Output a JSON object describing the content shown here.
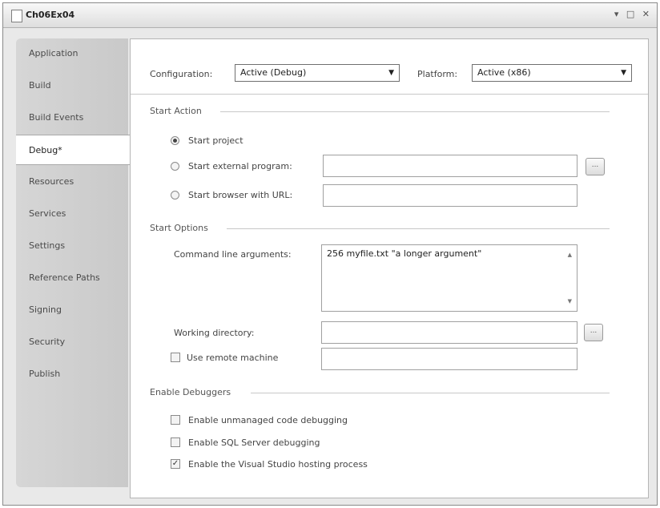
{
  "window": {
    "title": "Ch06Ex04",
    "controls": "▾ □ ✕"
  },
  "sidebar": {
    "tabs": [
      {
        "label": "Application",
        "active": false
      },
      {
        "label": "Build",
        "active": false
      },
      {
        "label": "Build Events",
        "active": false
      },
      {
        "label": "Debug*",
        "active": true
      },
      {
        "label": "Resources",
        "active": false
      },
      {
        "label": "Services",
        "active": false
      },
      {
        "label": "Settings",
        "active": false
      },
      {
        "label": "Reference Paths",
        "active": false
      },
      {
        "label": "Signing",
        "active": false
      },
      {
        "label": "Security",
        "active": false
      },
      {
        "label": "Publish",
        "active": false
      }
    ]
  },
  "config": {
    "configuration_label": "Configuration:",
    "configuration_value": "Active (Debug)",
    "platform_label": "Platform:",
    "platform_value": "Active (x86)"
  },
  "start_action": {
    "title": "Start Action",
    "start_project": "Start project",
    "start_external": "Start external program:",
    "start_browser": "Start browser with URL:",
    "external_value": "",
    "url_value": "",
    "browse_label": "..."
  },
  "start_options": {
    "title": "Start Options",
    "cmd_label": "Command line arguments:",
    "cmd_value": "256 myfile.txt \"a longer argument\"",
    "workdir_label": "Working directory:",
    "workdir_value": "",
    "remote_label": "Use remote machine",
    "remote_value": "",
    "browse_label": "..."
  },
  "debuggers": {
    "title": "Enable Debuggers",
    "unmanaged": {
      "label": "Enable unmanaged code debugging",
      "checked": false
    },
    "sql": {
      "label": "Enable SQL Server debugging",
      "checked": false
    },
    "hosting": {
      "label": "Enable the Visual Studio hosting process",
      "checked": true
    }
  }
}
